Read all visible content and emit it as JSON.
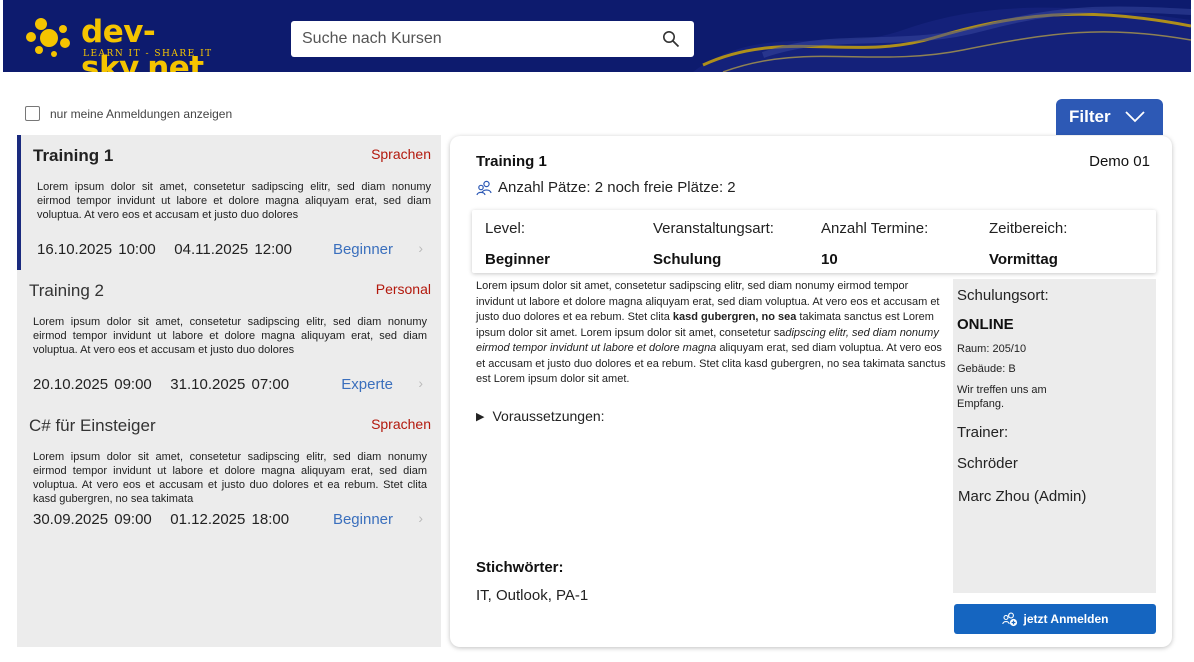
{
  "header": {
    "logo_text": "dev-sky.net",
    "logo_tagline": "LEARN IT - SHARE IT",
    "search_placeholder": "Suche nach Kursen",
    "colors": {
      "bar": "#0d1b6e",
      "logo": "#f5c400"
    }
  },
  "filters": {
    "only_mine_label": "nur meine Anmeldungen anzeigen",
    "only_mine_checked": false,
    "filter_button_label": "Filter"
  },
  "courses": [
    {
      "title": "Training 1",
      "category": "Sprachen",
      "description": "Lorem ipsum dolor sit amet, consetetur sadipscing elitr, sed diam nonumy eirmod tempor invidunt ut labore et dolore magna aliquyam erat, sed diam voluptua. At vero eos et accusam et justo duo dolores",
      "start": "16.10.2025 10:00",
      "end": "04.11.2025 12:00",
      "level": "Beginner",
      "selected": true
    },
    {
      "title": "Training 2",
      "category": "Personal",
      "description": "Lorem ipsum dolor sit amet, consetetur sadipscing elitr, sed diam nonumy eirmod tempor invidunt ut labore et dolore magna aliquyam erat, sed diam voluptua. At vero eos et accusam et justo duo dolores",
      "start": "20.10.2025 09:00",
      "end": "31.10.2025 07:00",
      "level": "Experte",
      "selected": false
    },
    {
      "title": "C# für Einsteiger",
      "category": "Sprachen",
      "description": "Lorem ipsum dolor sit amet, consetetur sadipscing elitr, sed diam nonumy eirmod tempor invidunt ut labore et dolore magna aliquyam erat, sed diam voluptua. At vero eos et accusam et justo duo dolores et ea rebum. Stet clita kasd gubergren, no sea takimata",
      "start": "30.09.2025 09:00",
      "end": "01.12.2025 18:00",
      "level": "Beginner",
      "selected": false
    }
  ],
  "detail": {
    "title": "Training 1",
    "code": "Demo 01",
    "seats_text": "Anzahl Pätze: 2 noch freie Plätze: 2",
    "stats": [
      {
        "label": "Level:",
        "value": "Beginner"
      },
      {
        "label": "Veranstaltungsart:",
        "value": "Schulung"
      },
      {
        "label": "Anzahl Termine:",
        "value": "10"
      },
      {
        "label": "Zeitbereich:",
        "value": "Vormittag"
      }
    ],
    "description_parts": {
      "p1": "Lorem ipsum dolor sit amet, consetetur sadipscing elitr, sed diam nonumy eirmod tempor invidunt ut labore et dolore magna aliquyam erat, sed diam voluptua. At vero eos et accusam et justo duo dolores et ea rebum. Stet clita ",
      "bold": "kasd gubergren, no sea",
      "p2": " takimata sanctus est Lorem ipsum dolor sit amet. Lorem ipsum dolor sit amet, consetetur sa",
      "italic": "dipscing elitr, sed diam nonumy eirmod tempor invidunt ut labore et dolore magna",
      "p3": " aliquyam erat, sed diam voluptua. At vero eos et accusam et justo duo dolores et ea rebum. Stet clita kasd gubergren, no sea takimata sanctus est Lorem ipsum dolor sit amet."
    },
    "prerequisites_label": "Voraussetzungen:",
    "keywords_label": "Stichwörter:",
    "keywords_value": "IT, Outlook, PA-1",
    "location": {
      "label": "Schulungsort:",
      "value": "ONLINE",
      "room": "Raum: 205/10",
      "building": "Gebäude: B",
      "note": "Wir treffen uns am Empfang."
    },
    "trainer": {
      "label": "Trainer:",
      "names": [
        "Schröder",
        "Marc Zhou (Admin)"
      ]
    },
    "enroll_label": "jetzt Anmelden",
    "colors": {
      "enroll": "#1565c0",
      "category": "#b3180c",
      "level": "#3a6fbd"
    }
  }
}
